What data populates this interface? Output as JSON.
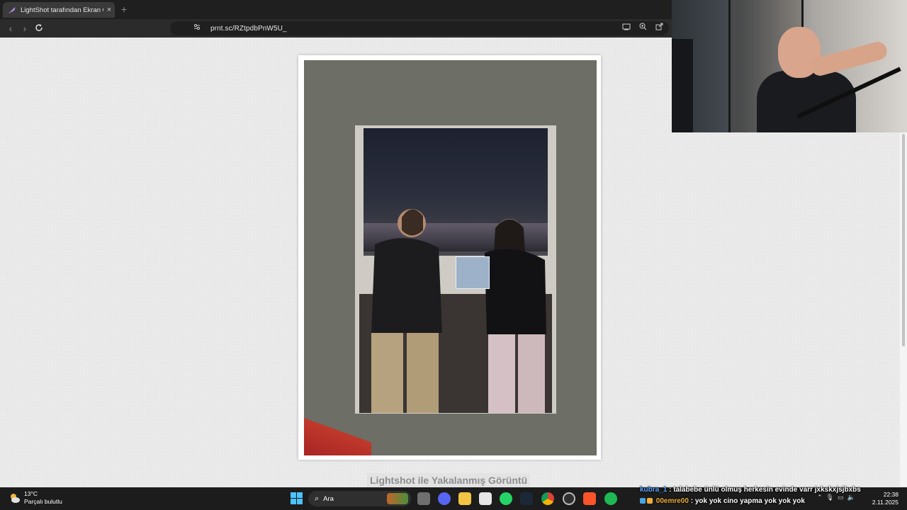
{
  "browser": {
    "tab": {
      "title": "LightShot tarafından Ekran Görü",
      "close_label": "×"
    },
    "new_tab_label": "+",
    "url": "prnt.sc/RZtpdbPnW5U_"
  },
  "page": {
    "caption": "Lightshot ile Yakalanmış Görüntü"
  },
  "taskbar": {
    "weather": {
      "temperature": "13°C",
      "condition": "Parçalı bulutlu"
    },
    "search_placeholder": "Ara",
    "clock": {
      "time": "22:38",
      "date": "2.11.2025"
    },
    "apps": [
      "file-explorer",
      "discord",
      "folder",
      "microsoft-store",
      "whatsapp",
      "steam",
      "chrome",
      "obs",
      "brave",
      "spotify"
    ]
  },
  "chat": [
    {
      "user": "kubra_1",
      "message": ": talabebe ünlü olmuş herkesin evinde varr jxkskxjsjbxbs"
    },
    {
      "user": "00emre00",
      "message": ": yok yok cino yapma yok yok yok"
    }
  ],
  "colors": {
    "accent": "#4cc2ff",
    "chat_user1": "#5aa7ff",
    "chat_user2": "#f0b03a"
  }
}
